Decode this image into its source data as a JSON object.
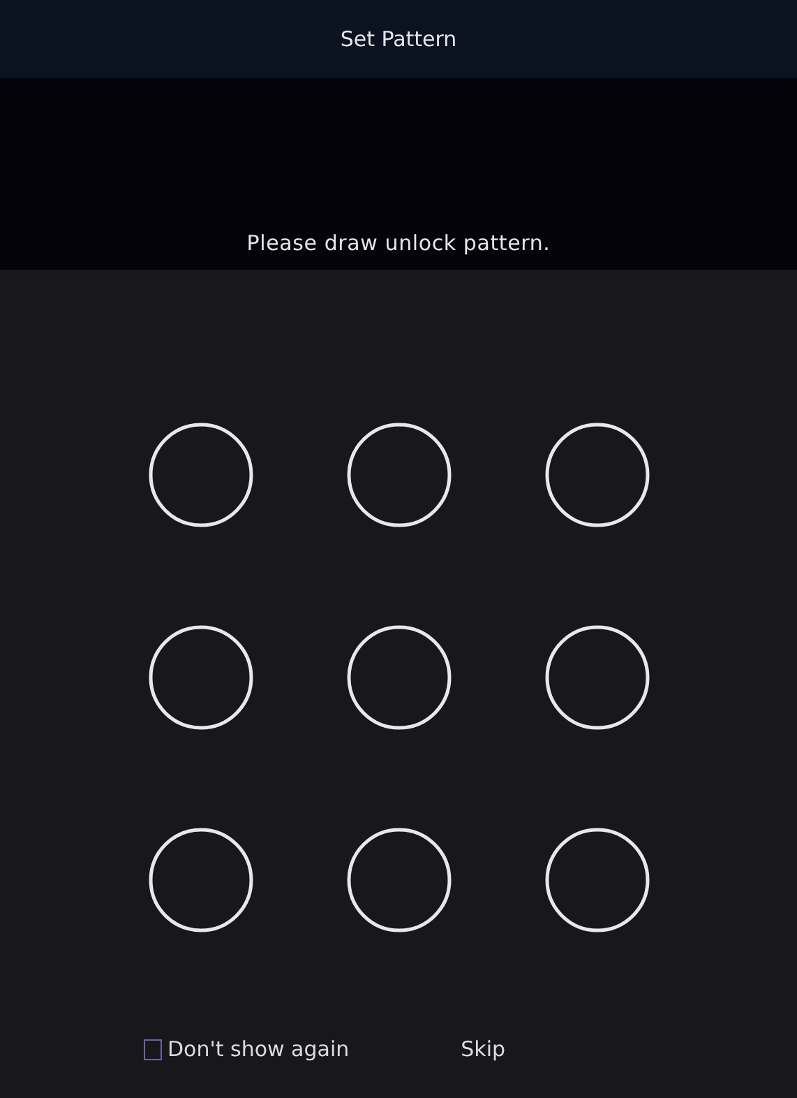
{
  "window": {
    "title": "Set Pattern"
  },
  "prompt": "Please draw unlock pattern.",
  "pattern_dots": [
    {
      "selected": false
    },
    {
      "selected": false
    },
    {
      "selected": false
    },
    {
      "selected": false
    },
    {
      "selected": false
    },
    {
      "selected": false
    },
    {
      "selected": false
    },
    {
      "selected": false
    },
    {
      "selected": false
    }
  ],
  "dont_show_again": {
    "label": "Don't show again",
    "checked": false
  },
  "skip": {
    "label": "Skip"
  }
}
